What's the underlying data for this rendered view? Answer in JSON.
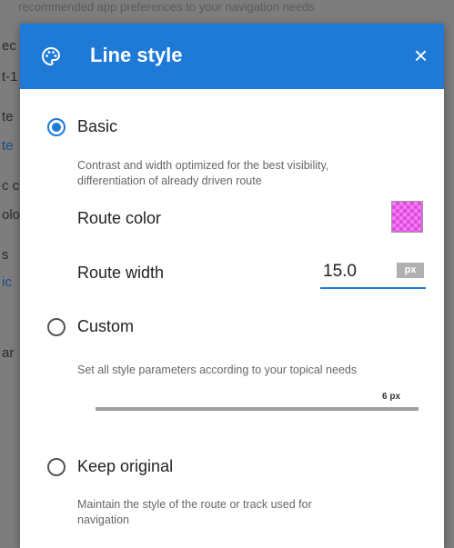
{
  "background": {
    "top_line": "recommended app preferences to your navigation needs",
    "fragments": [
      "ec",
      "t-1",
      "te",
      "te",
      "c c",
      "olo",
      "s",
      "ic",
      "ar"
    ]
  },
  "dialog": {
    "title": "Line style",
    "close_glyph": "×",
    "icon": "palette-icon",
    "options": {
      "basic": {
        "label": "Basic",
        "selected": true,
        "description": "Contrast and width optimized for the best visibility,\ndifferentiation of already driven route"
      },
      "custom": {
        "label": "Custom",
        "selected": false,
        "description": "Set all style parameters according to your topical needs",
        "slider_value": "6 px"
      },
      "keep_original": {
        "label": "Keep original",
        "selected": false,
        "description": "Maintain the style of the route or track used for\nnavigation"
      }
    },
    "route_color": {
      "label": "Route color",
      "color": "#f27af2"
    },
    "route_width": {
      "label": "Route width",
      "value": "15.0",
      "unit": "px"
    }
  },
  "colors": {
    "accent": "#1e7ad6",
    "overlay": "#7d7d7d"
  }
}
